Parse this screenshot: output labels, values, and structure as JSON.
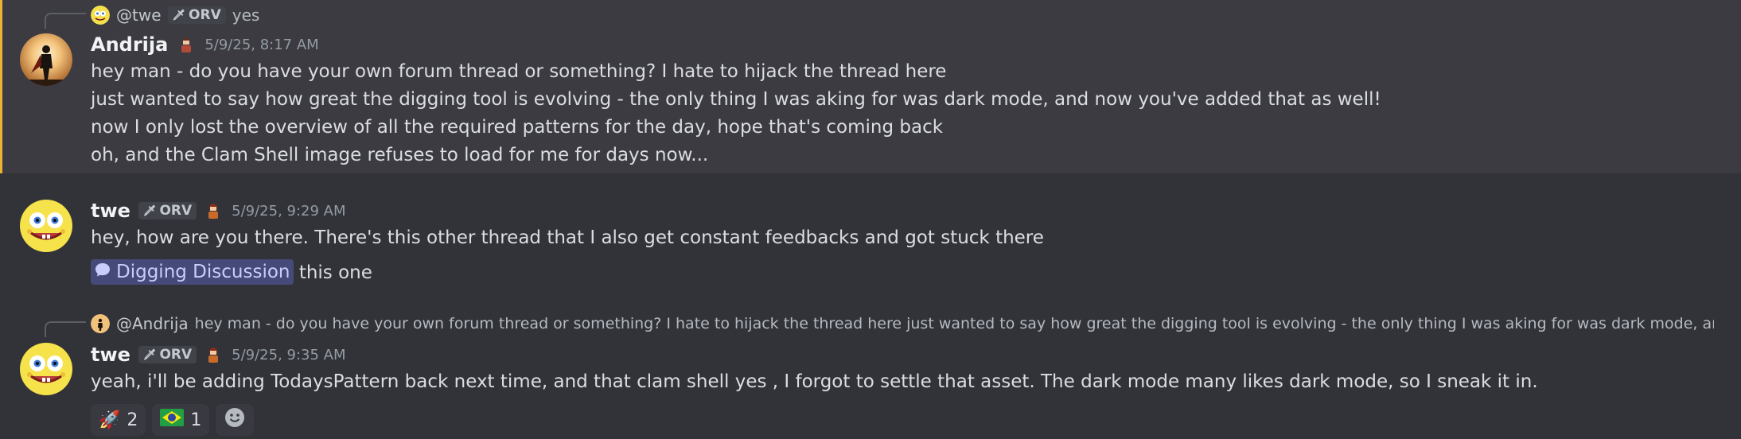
{
  "messages": [
    {
      "reply": {
        "name": "@twe",
        "tag": "ORV",
        "text": "yes"
      },
      "author": "Andrija",
      "timestamp": "5/9/25, 8:17 AM",
      "lines": [
        "hey man - do you have your own forum thread or something? I hate to hijack the thread here",
        "just wanted to say how great the digging tool is evolving - the only thing I was aking for was dark mode, and now you've added that as well!",
        "now I only lost the overview of all the required patterns for the day, hope that's coming back",
        "oh, and the Clam Shell image refuses to load for me for days now..."
      ]
    },
    {
      "author": "twe",
      "tag": "ORV",
      "timestamp": "5/9/25, 9:29 AM",
      "lines": [
        "hey, how are you there. There's this other thread that I also get constant feedbacks and got stuck there"
      ],
      "channel_mention": "Digging Discussion",
      "after_mention": "this one"
    },
    {
      "reply": {
        "name": "@Andrija",
        "text": "hey man - do you have your own forum thread or something? I hate to hijack the thread here just wanted to say how great the digging tool is evolving - the only thing I was aking for was dark mode, and ..."
      },
      "author": "twe",
      "tag": "ORV",
      "timestamp": "5/9/25, 9:35 AM",
      "lines": [
        "yeah,  i'll be adding TodaysPattern back next time, and that clam shell yes , I forgot to settle that asset. The dark mode many likes dark mode, so I sneak it in."
      ],
      "reactions": [
        {
          "emoji": "🚀",
          "count": "2"
        },
        {
          "emoji": "🇧🇷",
          "count": "1"
        }
      ]
    }
  ],
  "colors": {
    "background": "#323339",
    "highlight": "#3b3b41",
    "mention_bar": "#f0b232",
    "channel_mention_bg": "#454a78",
    "channel_mention_text": "#c9cdfb"
  }
}
